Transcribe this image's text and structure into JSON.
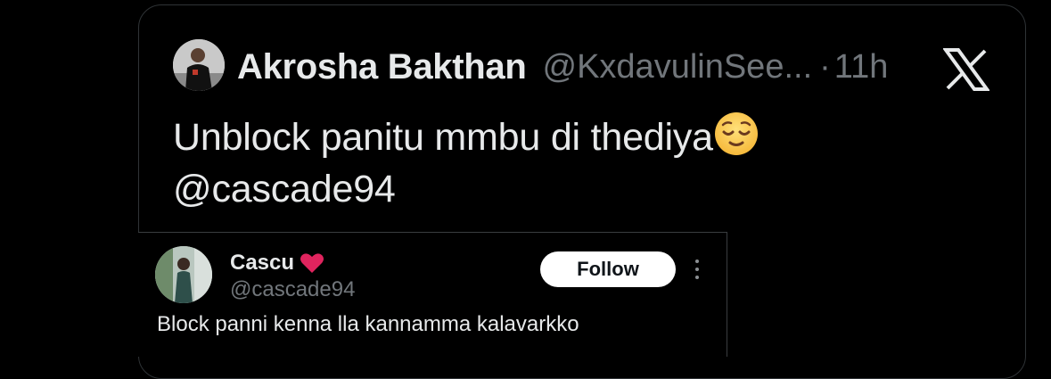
{
  "tweet": {
    "author_name": "Akrosha Bakthan",
    "author_handle": "@KxdavulinSee...",
    "separator": "·",
    "time": "11h",
    "text_line1": "Unblock panitu mmbu di thediya",
    "text_line2": "@cascade94",
    "emoji": "relieved-face-emoji"
  },
  "quoted": {
    "name": "Cascu",
    "name_badge": "red-heart-icon",
    "handle": "@cascade94",
    "follow_label": "Follow",
    "text_peek": "Block panni kenna lla kannamma kalavarkko"
  },
  "colors": {
    "background": "#000000",
    "primary_text": "#e7e9ea",
    "secondary_text": "#71767b",
    "border": "#2f3336",
    "heart": "#f91880"
  },
  "icons": {
    "brand": "x-logo-icon",
    "more": "more-dots-icon"
  }
}
